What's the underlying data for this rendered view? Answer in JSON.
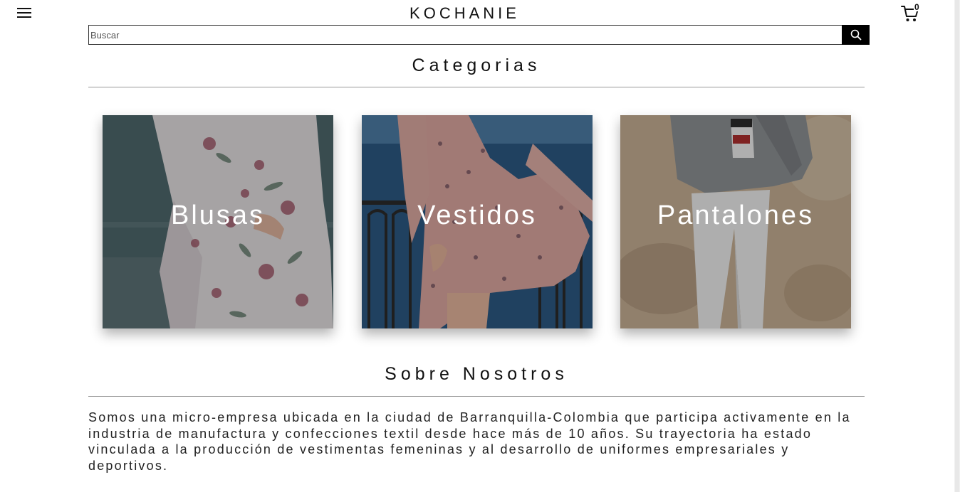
{
  "header": {
    "brand": "KOCHANIE",
    "cart_count": "0",
    "menu_icon": "hamburger-menu-icon",
    "cart_icon": "shopping-cart-icon"
  },
  "search": {
    "placeholder": "Buscar",
    "value": "",
    "button_icon": "search-icon"
  },
  "categories": {
    "title": "Categorias",
    "items": [
      {
        "label": "Blusas"
      },
      {
        "label": "Vestidos"
      },
      {
        "label": "Pantalones"
      }
    ]
  },
  "about": {
    "title": "Sobre Nosotros",
    "text": "Somos una micro-empresa ubicada en la ciudad de Barranquilla-Colombia que participa activamente en la industria de manufactura y confecciones textil desde hace más de 10 años. Su trayectoria ha estado vinculada a la producción de vestimentas femeninas y al desarrollo de uniformes empresariales y deportivos."
  },
  "colors": {
    "accent": "#000000",
    "text": "#111111",
    "rule": "#999999"
  }
}
